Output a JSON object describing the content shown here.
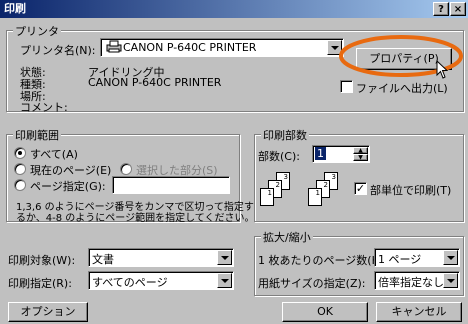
{
  "title": "印刷",
  "titlebar": {
    "help": "?",
    "close": "×"
  },
  "printer": {
    "group_label": "プリンタ",
    "name_label": "プリンタ名(N):",
    "name_value": "CANON P-640C PRINTER",
    "properties_button": "プロパティ(P)",
    "status_label": "状態:",
    "status_value": "アイドリング中",
    "type_label": "種類:",
    "type_value": "CANON P-640C PRINTER",
    "location_label": "場所:",
    "comment_label": "コメント:",
    "print_to_file": "ファイルへ出力(L)",
    "print_to_file_checked": false
  },
  "range": {
    "group_label": "印刷範囲",
    "all": "すべて(A)",
    "current": "現在のページ(E)",
    "selection": "選択した部分(S)",
    "pages": "ページ指定(G):",
    "pages_value": "",
    "hint_line1": "1,3,6 のようにページ番号をカンマで区切って指定す",
    "hint_line2": "るか、4-8 のようにページ範囲を指定してください。",
    "selected": "all"
  },
  "copies": {
    "group_label": "印刷部数",
    "count_label": "部数(C):",
    "count_value": "1",
    "collate_label": "部単位で印刷(T)",
    "collate_checked": true
  },
  "print_what": {
    "label": "印刷対象(W):",
    "value": "文書"
  },
  "print_pages": {
    "label": "印刷指定(R):",
    "value": "すべてのページ"
  },
  "zoom": {
    "group_label": "拡大/縮小",
    "pages_per_sheet_label": "1 枚あたりのページ数(H):",
    "pages_per_sheet_value": "1 ページ",
    "paper_size_label": "用紙サイズの指定(Z):",
    "paper_size_value": "倍率指定なし"
  },
  "buttons": {
    "options": "オプション(O)...",
    "ok": "OK",
    "cancel": "キャンセル"
  },
  "colors": {
    "title_start": "#0a246a",
    "title_end": "#a6caf0",
    "highlight_ring": "#e86a10"
  }
}
